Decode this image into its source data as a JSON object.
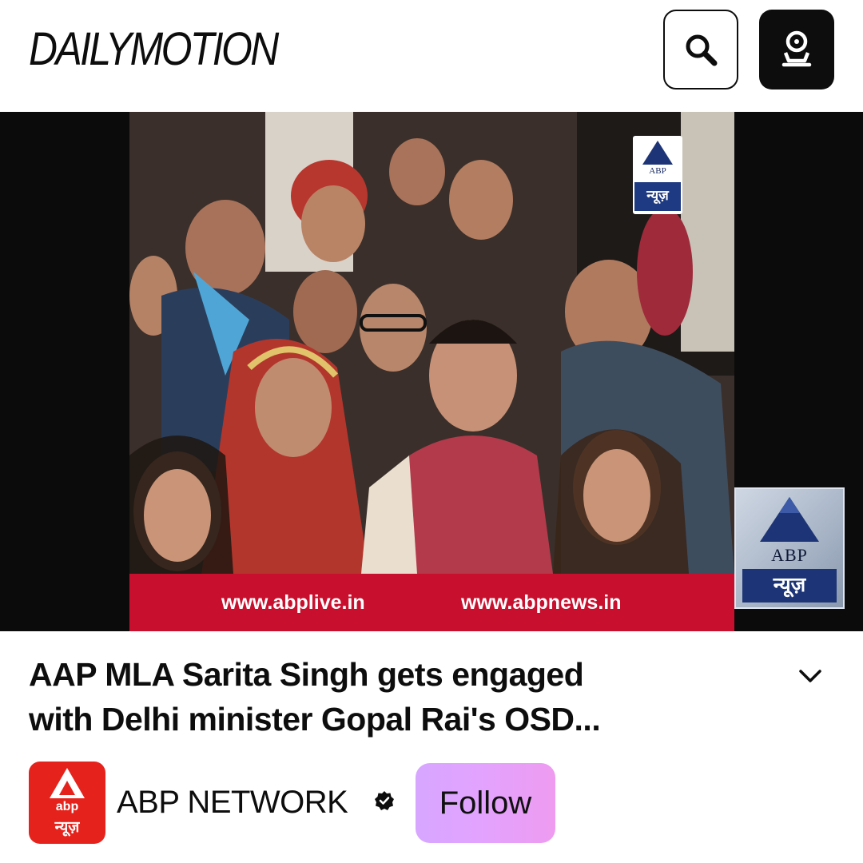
{
  "header": {
    "logo_text": "DAILYMOTION",
    "search_icon": "search-icon",
    "account_icon": "account-icon"
  },
  "player": {
    "url_left": "www.abplive.in",
    "url_right": "www.abpnews.in",
    "watermark_small": {
      "word": "ABP",
      "hindi": "न्यूज़"
    },
    "watermark_big": {
      "word": "ABP",
      "hindi": "न्यूज़"
    },
    "bar_color": "#c8102e"
  },
  "video": {
    "title_line1": "AAP MLA Sarita Singh gets engaged",
    "title_line2": "with Delhi minister Gopal Rai's OSD...",
    "expand_icon": "chevron-down-icon"
  },
  "channel": {
    "avatar_abp": "abp",
    "avatar_hindi": "न्यूज़",
    "name": "ABP NETWORK",
    "verified_icon": "verified-badge-icon",
    "follow_label": "Follow",
    "avatar_color": "#e5231c"
  }
}
